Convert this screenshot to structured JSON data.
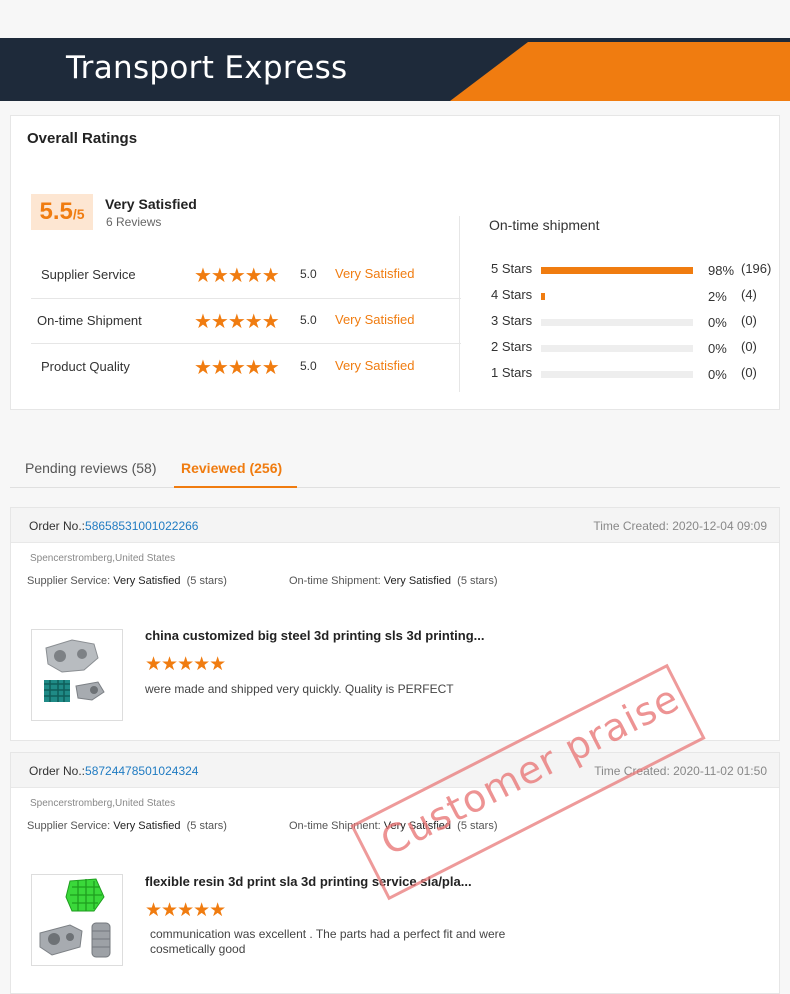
{
  "banner": {
    "title": "Transport Express"
  },
  "ratings": {
    "title": "Overall Ratings",
    "score": "5.5",
    "score_max": "/5",
    "summary": "Very Satisfied",
    "reviews": "6 Reviews",
    "rows": [
      {
        "label": "Supplier Service",
        "stars": "★★★★★",
        "value": "5.0",
        "text": "Very Satisfied"
      },
      {
        "label": "On-time Shipment",
        "stars": "★★★★★",
        "value": "5.0",
        "text": "Very Satisfied"
      },
      {
        "label": "Product Quality",
        "stars": "★★★★★",
        "value": "5.0",
        "text": "Very Satisfied"
      }
    ],
    "shipment": {
      "title": "On-time shipment",
      "rows": [
        {
          "label": "5 Stars",
          "pct": "98%",
          "count": "(196)",
          "fill": 1.0
        },
        {
          "label": "4 Stars",
          "pct": "2%",
          "count": "(4)",
          "fill": 0.02
        },
        {
          "label": "3 Stars",
          "pct": "0%",
          "count": "(0)",
          "fill": 0
        },
        {
          "label": "2 Stars",
          "pct": "0%",
          "count": "(0)",
          "fill": 0
        },
        {
          "label": "1 Stars",
          "pct": "0%",
          "count": "(0)",
          "fill": 0
        }
      ]
    }
  },
  "tabs": {
    "pending": "Pending reviews (58)",
    "reviewed": "Reviewed (256)"
  },
  "reviews": [
    {
      "order_label": "Order No.:",
      "order_no": "58658531001022266",
      "time": "Time Created: 2020-12-04 09:09",
      "user": "Spencerstromberg,United States",
      "supplier_label": "Supplier Service:",
      "supplier_value": "Very Satisfied",
      "supplier_stars": "(5 stars)",
      "shipment_label": "On-time Shipment:",
      "shipment_value": "Very Satisfied",
      "shipment_stars": "(5 stars)",
      "product_title": "china customized  big steel 3d printing sls 3d printing...",
      "stars": "★★★★★",
      "text": "were made and shipped very quickly. Quality is PERFECT"
    },
    {
      "order_label": "Order No.:",
      "order_no": "58724478501024324",
      "time": "Time Created: 2020-11-02 01:50",
      "user": "Spencerstromberg,United States",
      "supplier_label": "Supplier Service:",
      "supplier_value": "Very Satisfied",
      "supplier_stars": "(5 stars)",
      "shipment_label": "On-time Shipment:",
      "shipment_value": "Very Satisfied",
      "shipment_stars": "(5 stars)",
      "product_title": "flexible resin 3d print sla 3d printing service sla/pla...",
      "stars": "★★★★★",
      "text": "communication was excellent . The parts had a perfect fit and were cosmetically good"
    }
  ],
  "stamp": "Customer praise",
  "colors": {
    "accent": "#f07c10",
    "navy": "#1e2a3a",
    "link": "#1f7bc2"
  }
}
